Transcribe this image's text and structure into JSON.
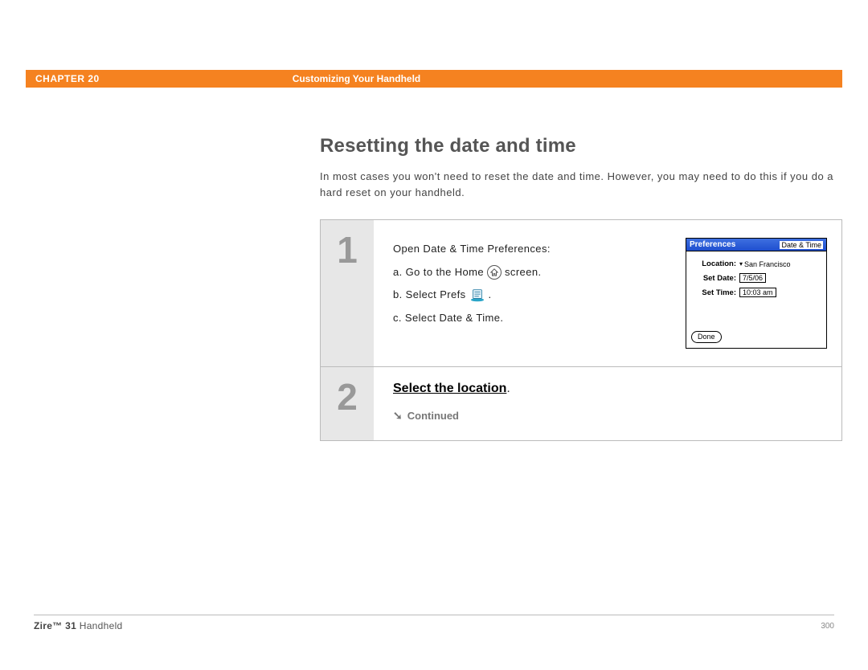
{
  "header": {
    "chapter_label": "CHAPTER 20",
    "chapter_title": "Customizing Your Handheld"
  },
  "section": {
    "heading": "Resetting the date and time",
    "intro": "In most cases you won't need to reset the date and time. However, you may need to do this if you do a hard reset on your handheld."
  },
  "steps": {
    "step1": {
      "num": "1",
      "open_line": "Open Date & Time Preferences:",
      "a_prefix": "a.  Go to the Home",
      "a_suffix": "screen.",
      "b_prefix": "b.  Select Prefs",
      "b_suffix": ".",
      "c": "c.  Select Date & Time."
    },
    "step2": {
      "num": "2",
      "link": "Select the location",
      "link_suffix": ".",
      "continued": "Continued"
    }
  },
  "device": {
    "title_left": "Preferences",
    "title_right": "Date & Time",
    "location_label": "Location:",
    "location_value": "San Francisco",
    "set_date_label": "Set Date:",
    "set_date_value": "7/5/06",
    "set_time_label": "Set Time:",
    "set_time_value": "10:03 am",
    "done": "Done"
  },
  "footer": {
    "product_bold": "Zire™ 31",
    "product_rest": " Handheld",
    "page_number": "300"
  }
}
